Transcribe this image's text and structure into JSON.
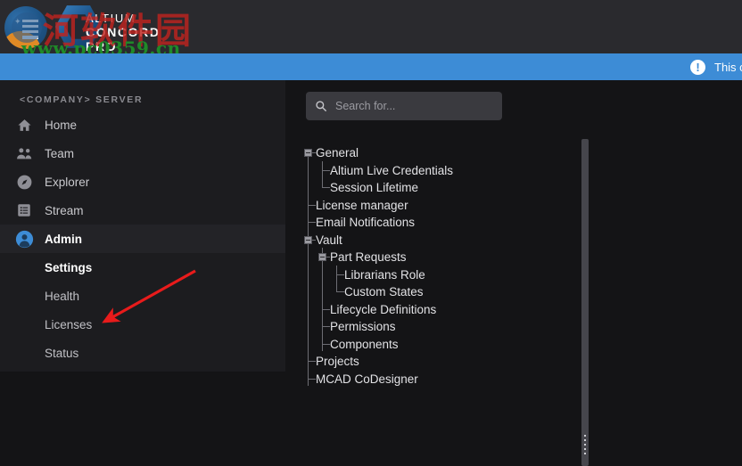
{
  "header": {
    "logo_line1": "ALTIUM",
    "logo_line2": "CONCORD PRO",
    "watermark_cn": "河软件园",
    "watermark_url": "www.pc0359.cn"
  },
  "notice": {
    "icon": "exclamation-circle-icon",
    "text": "This c",
    "background": "#3d8cd6"
  },
  "sidebar": {
    "title": "<COMPANY> SERVER",
    "items": [
      {
        "label": "Home",
        "icon": "home-icon",
        "active": false
      },
      {
        "label": "Team",
        "icon": "people-icon",
        "active": false
      },
      {
        "label": "Explorer",
        "icon": "compass-icon",
        "active": false
      },
      {
        "label": "Stream",
        "icon": "list-document-icon",
        "active": false
      },
      {
        "label": "Admin",
        "icon": "user-circle-icon",
        "active": true
      }
    ],
    "sub_items": [
      {
        "label": "Settings",
        "current": true
      },
      {
        "label": "Health",
        "current": false
      },
      {
        "label": "Licenses",
        "current": false
      },
      {
        "label": "Status",
        "current": false
      }
    ],
    "accent": "#3d8cd6"
  },
  "search": {
    "placeholder": "Search for...",
    "value": "",
    "icon": "search-icon"
  },
  "tree": {
    "nodes": [
      {
        "label": "General",
        "level": 0,
        "expandable": true,
        "expanded": true
      },
      {
        "label": "Altium Live Credentials",
        "level": 1,
        "expandable": false,
        "expanded": false
      },
      {
        "label": "Session Lifetime",
        "level": 1,
        "expandable": false,
        "expanded": false
      },
      {
        "label": "License manager",
        "level": 0,
        "expandable": false,
        "expanded": false
      },
      {
        "label": "Email Notifications",
        "level": 0,
        "expandable": false,
        "expanded": false
      },
      {
        "label": "Vault",
        "level": 0,
        "expandable": true,
        "expanded": true
      },
      {
        "label": "Part Requests",
        "level": 1,
        "expandable": true,
        "expanded": true
      },
      {
        "label": "Librarians Role",
        "level": 2,
        "expandable": false,
        "expanded": false
      },
      {
        "label": "Custom States",
        "level": 2,
        "expandable": false,
        "expanded": false
      },
      {
        "label": "Lifecycle Definitions",
        "level": 1,
        "expandable": false,
        "expanded": false
      },
      {
        "label": "Permissions",
        "level": 1,
        "expandable": false,
        "expanded": false
      },
      {
        "label": "Components",
        "level": 1,
        "expandable": false,
        "expanded": false
      },
      {
        "label": "Projects",
        "level": 0,
        "expandable": false,
        "expanded": false
      },
      {
        "label": "MCAD CoDesigner",
        "level": 0,
        "expandable": false,
        "expanded": false
      }
    ]
  },
  "annotation": {
    "color": "#e81b1b",
    "points_to": "Licenses"
  }
}
